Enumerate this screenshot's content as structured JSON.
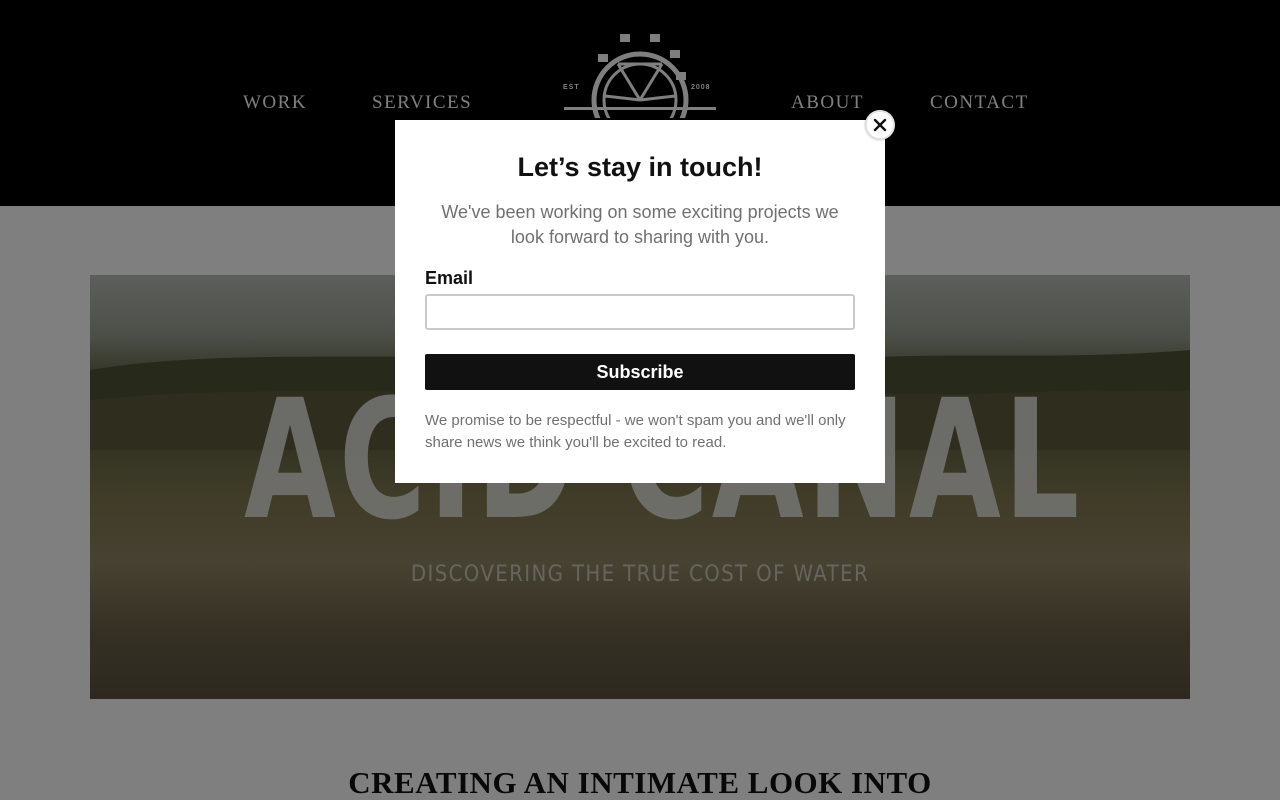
{
  "nav": {
    "work": "WORK",
    "services": "SERVICES",
    "about": "ABOUT",
    "contact": "CONTACT"
  },
  "logo": {
    "left_text": "EST",
    "right_text": "2008",
    "icon": "ferris-wheel-icon"
  },
  "hero": {
    "title": "ACID CANAL",
    "subtitle": "DISCOVERING THE TRUE COST OF WATER"
  },
  "section": {
    "heading": "CREATING AN INTIMATE LOOK INTO"
  },
  "modal": {
    "title": "Let’s stay in touch!",
    "description": "We've been working on some exciting projects we look forward to sharing with you.",
    "email_label": "Email",
    "email_value": "",
    "subscribe_label": "Subscribe",
    "promise": "We promise to be respectful - we won't spam you and we'll only share news we think you'll be excited to read.",
    "close_icon": "close-icon"
  },
  "colors": {
    "header_bg": "#000000",
    "button_bg": "#111111",
    "muted_text": "#707070"
  }
}
